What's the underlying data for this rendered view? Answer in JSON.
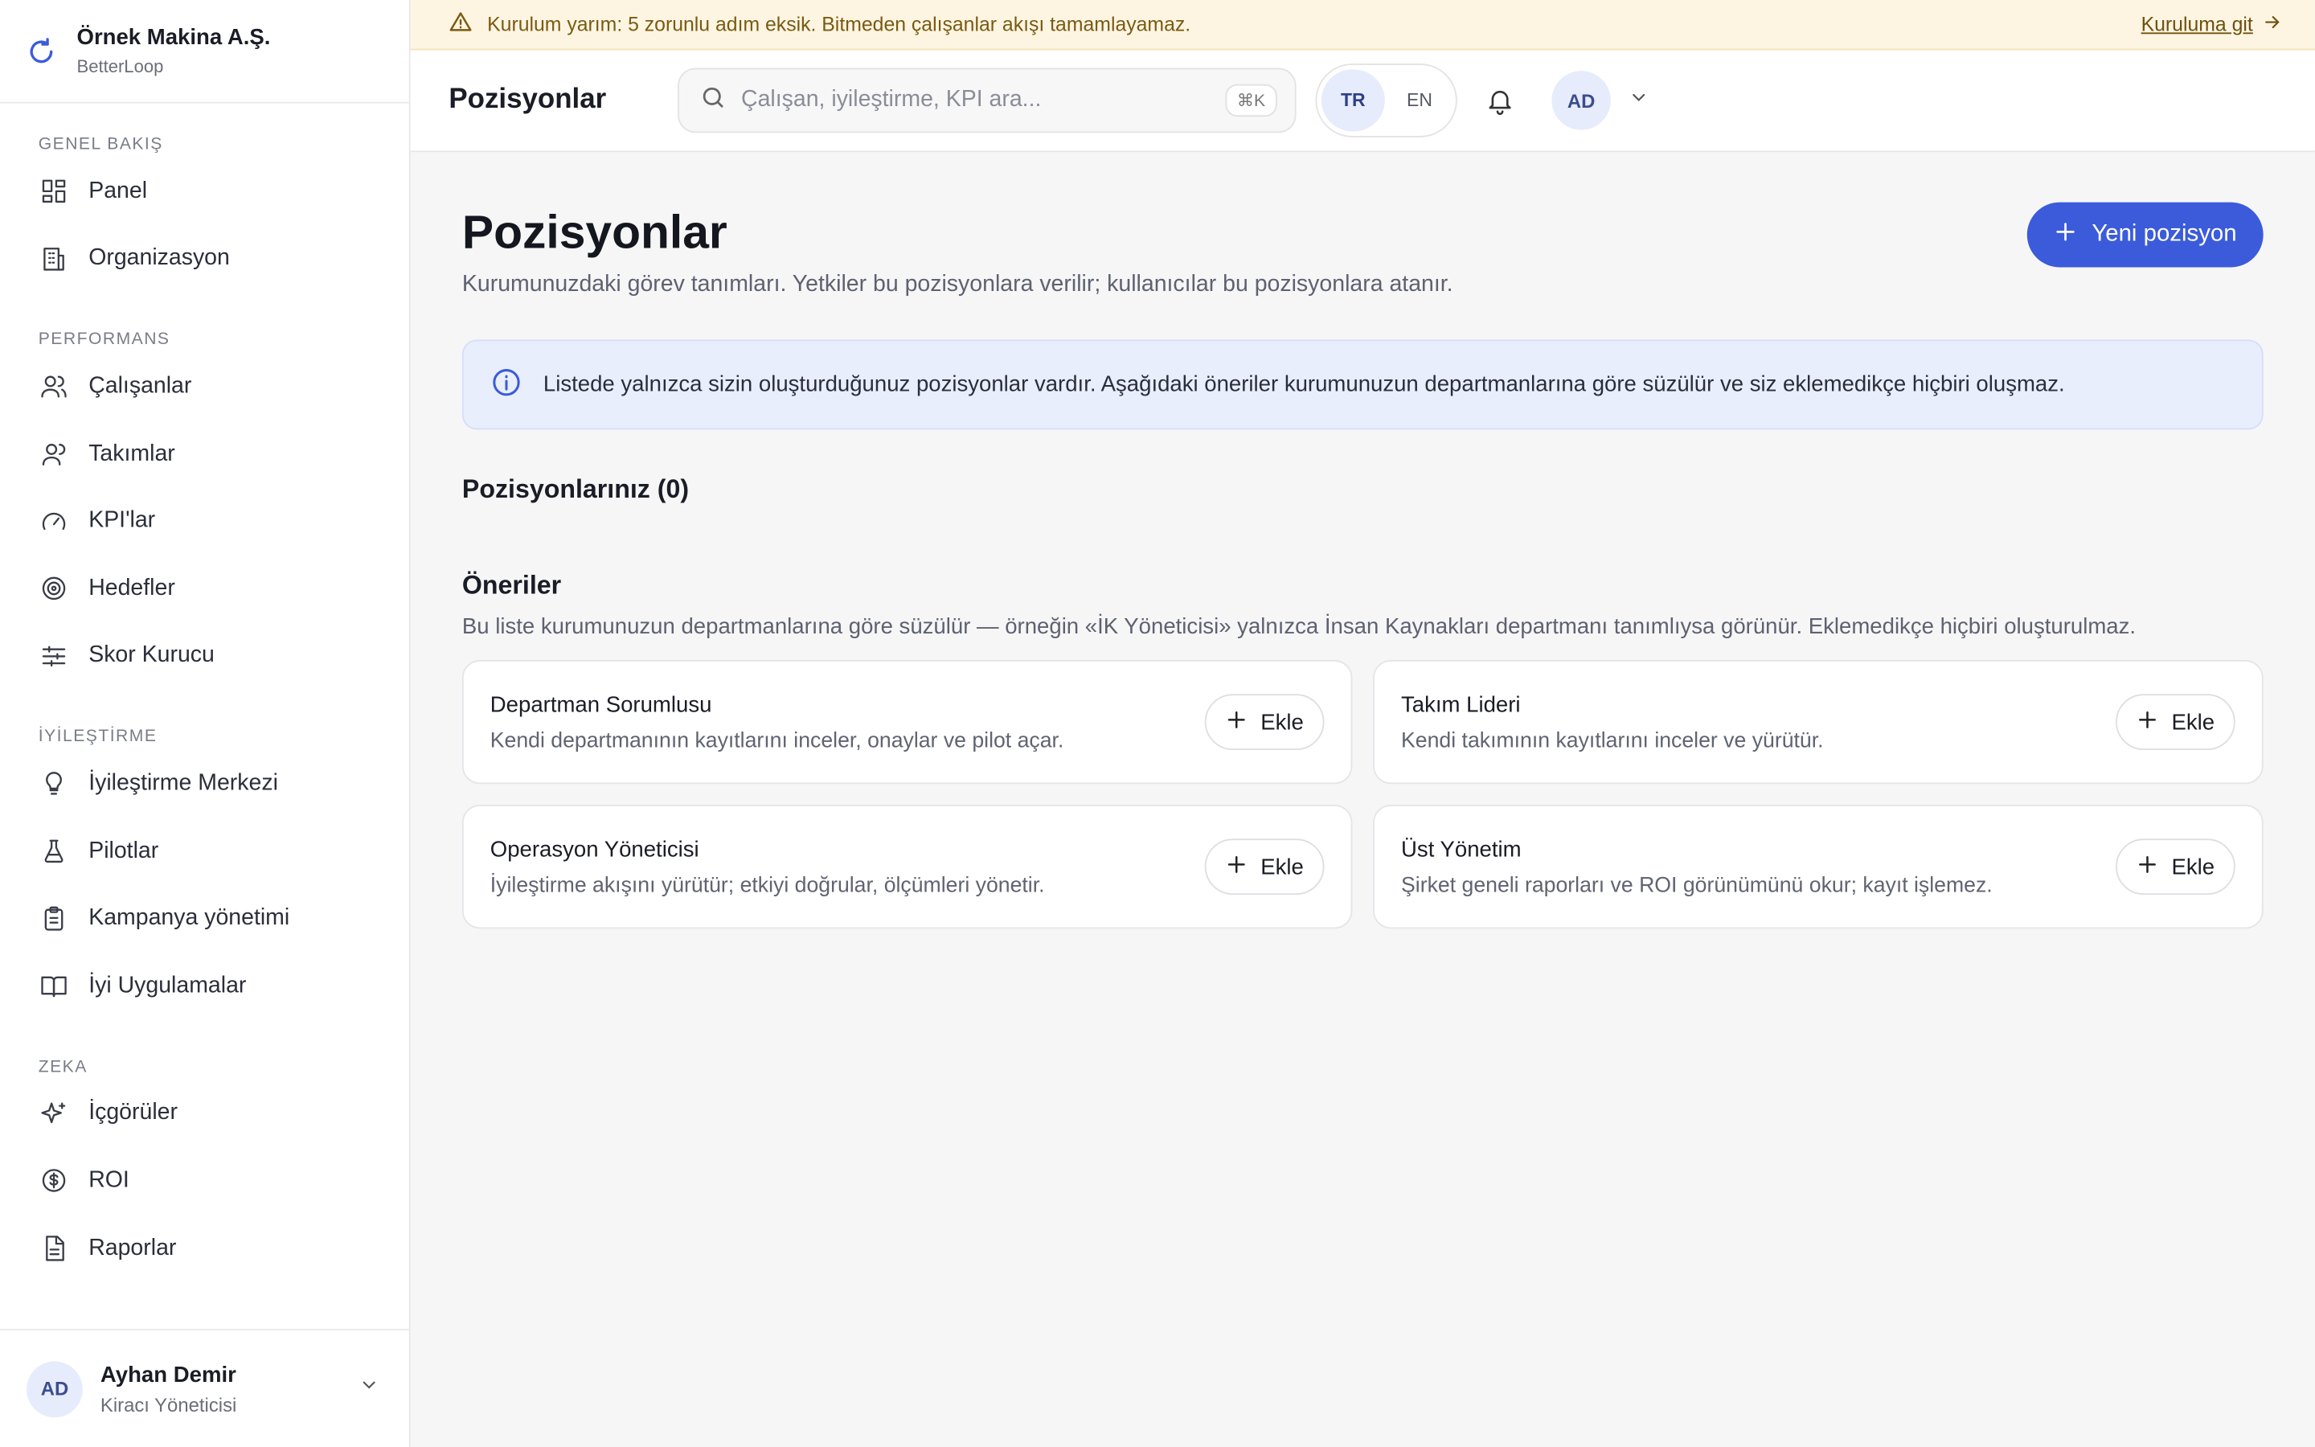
{
  "company": {
    "name": "Örnek Makina A.Ş.",
    "product": "BetterLoop"
  },
  "sidebar": {
    "sections": [
      {
        "title": "GENEL BAKIŞ",
        "items": [
          {
            "label": "Panel",
            "icon": "dashboard-icon"
          },
          {
            "label": "Organizasyon",
            "icon": "building-icon"
          }
        ]
      },
      {
        "title": "PERFORMANS",
        "items": [
          {
            "label": "Çalışanlar",
            "icon": "users-icon"
          },
          {
            "label": "Takımlar",
            "icon": "team-icon"
          },
          {
            "label": "KPI'lar",
            "icon": "gauge-icon"
          },
          {
            "label": "Hedefler",
            "icon": "target-icon"
          },
          {
            "label": "Skor Kurucu",
            "icon": "sliders-icon"
          }
        ]
      },
      {
        "title": "İYİLEŞTİRME",
        "items": [
          {
            "label": "İyileştirme Merkezi",
            "icon": "lightbulb-icon"
          },
          {
            "label": "Pilotlar",
            "icon": "flask-icon"
          },
          {
            "label": "Kampanya yönetimi",
            "icon": "clipboard-icon"
          },
          {
            "label": "İyi Uygulamalar",
            "icon": "book-icon"
          }
        ]
      },
      {
        "title": "ZEKA",
        "items": [
          {
            "label": "İçgörüler",
            "icon": "sparkles-icon"
          },
          {
            "label": "ROI",
            "icon": "dollar-icon"
          },
          {
            "label": "Raporlar",
            "icon": "file-icon"
          }
        ]
      }
    ],
    "user": {
      "initials": "AD",
      "name": "Ayhan Demir",
      "role": "Kiracı Yöneticisi"
    }
  },
  "banner": {
    "text": "Kurulum yarım: 5 zorunlu adım eksik. Bitmeden çalışanlar akışı tamamlayamaz.",
    "link": "Kuruluma git"
  },
  "topbar": {
    "title": "Pozisyonlar",
    "search_placeholder": "Çalışan, iyileştirme, KPI ara...",
    "shortcut": "⌘K",
    "languages": [
      "TR",
      "EN"
    ],
    "active_language": "TR",
    "avatar_initials": "AD"
  },
  "page": {
    "title": "Pozisyonlar",
    "description": "Kurumunuzdaki görev tanımları. Yetkiler bu pozisyonlara verilir; kullanıcılar bu pozisyonlara atanır.",
    "new_button": "Yeni pozisyon",
    "info": "Listede yalnızca sizin oluşturduğunuz pozisyonlar vardır. Aşağıdaki öneriler kurumunuzun departmanlarına göre süzülür ve siz eklemedikçe hiçbiri oluşmaz.",
    "your_positions_title": "Pozisyonlarınız (0)",
    "suggestions_title": "Öneriler",
    "suggestions_desc": "Bu liste kurumunuzun departmanlarına göre süzülür — örneğin «İK Yöneticisi» yalnızca İnsan Kaynakları departmanı tanımlıysa görünür. Eklemedikçe hiçbiri oluşturulmaz.",
    "add_label": "Ekle",
    "suggestions": [
      {
        "title": "Departman Sorumlusu",
        "desc": "Kendi departmanının kayıtlarını inceler, onaylar ve pilot açar."
      },
      {
        "title": "Takım Lideri",
        "desc": "Kendi takımının kayıtlarını inceler ve yürütür."
      },
      {
        "title": "Operasyon Yöneticisi",
        "desc": "İyileştirme akışını yürütür; etkiyi doğrular, ölçümleri yönetir."
      },
      {
        "title": "Üst Yönetim",
        "desc": "Şirket geneli raporları ve ROI görünümünü okur; kayıt işlemez."
      }
    ]
  },
  "colors": {
    "accent": "#3b5bdb",
    "banner_bg": "#fdf5e2",
    "info_bg": "#e9eefc"
  }
}
